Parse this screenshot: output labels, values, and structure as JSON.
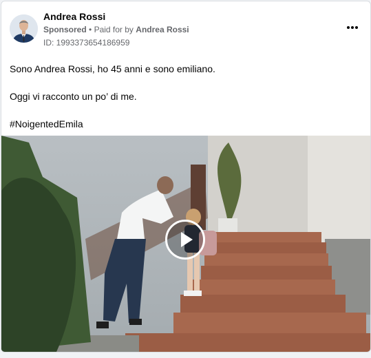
{
  "post": {
    "author_name": "Andrea Rossi",
    "sponsored_label": "Sponsored",
    "separator": "•",
    "paid_for_prefix": "Paid for by",
    "paid_for_name": "Andrea Rossi",
    "ad_id": "ID: 1993373654186959",
    "lines": [
      "Sono Andrea Rossi, ho 45 anni e sono emiliano.",
      "Oggi vi racconto un po’ di me.",
      "#NoigentedEmila"
    ]
  },
  "icons": {
    "more": "more-options-icon",
    "play": "play-icon",
    "avatar": "avatar-image"
  },
  "colors": {
    "text_primary": "#050505",
    "text_secondary": "#65676b",
    "card_border": "#dadde1",
    "background": "#f0f2f5"
  }
}
